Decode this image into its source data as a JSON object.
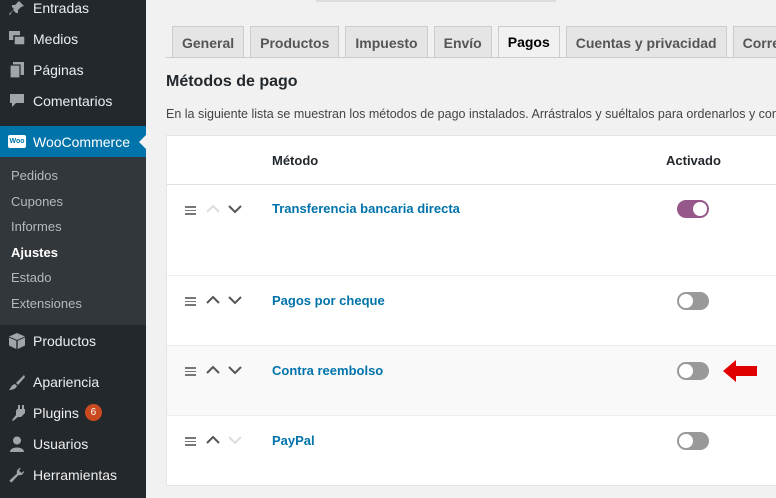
{
  "sidebar": {
    "items": [
      {
        "label": "Entradas",
        "icon": "pin-icon"
      },
      {
        "label": "Medios",
        "icon": "media-icon"
      },
      {
        "label": "Páginas",
        "icon": "pages-icon"
      },
      {
        "label": "Comentarios",
        "icon": "comment-icon"
      },
      {
        "label": "WooCommerce",
        "icon": "woocommerce-icon"
      },
      {
        "label": "Productos",
        "icon": "box-icon"
      },
      {
        "label": "Apariencia",
        "icon": "brush-icon"
      },
      {
        "label": "Plugins",
        "icon": "plugin-icon",
        "badge": "6"
      },
      {
        "label": "Usuarios",
        "icon": "user-icon"
      },
      {
        "label": "Herramientas",
        "icon": "wrench-icon"
      }
    ],
    "woo_logo_text": "Woo",
    "submenu": [
      "Pedidos",
      "Cupones",
      "Informes",
      "Ajustes",
      "Estado",
      "Extensiones"
    ],
    "current_submenu": "Ajustes"
  },
  "tabs": [
    "General",
    "Productos",
    "Impuesto",
    "Envío",
    "Pagos",
    "Cuentas y privacidad",
    "Correos electrónicos"
  ],
  "active_tab": "Pagos",
  "page_title": "Métodos de pago",
  "description": "En la siguiente lista se muestran los métodos de pago instalados. Arrástralos y suéltalos para ordenarlos y controlar el orden en que se muestran en la página de pago.",
  "table": {
    "headers": {
      "method": "Método",
      "enabled": "Activado"
    },
    "rows": [
      {
        "name": "Transferencia bancaria directa",
        "enabled": true
      },
      {
        "name": "Pagos por cheque",
        "enabled": false
      },
      {
        "name": "Contra reembolso",
        "enabled": false,
        "highlighted": true
      },
      {
        "name": "PayPal",
        "enabled": false
      }
    ]
  },
  "colors": {
    "sidebar": "#23282d",
    "accent": "#0073aa",
    "toggle_on": "#96588a",
    "highlight_arrow": "#e00000",
    "badge": "#ca4a1f"
  }
}
